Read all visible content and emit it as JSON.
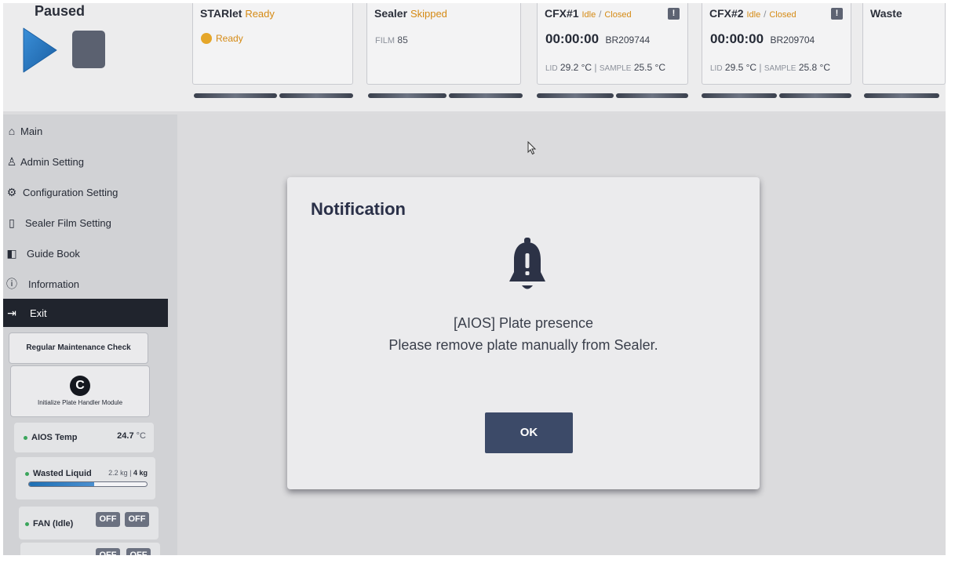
{
  "header": {
    "run_status": "Paused",
    "cards": {
      "starlet": {
        "name": "STARlet",
        "status": "Ready",
        "state_text": "Ready"
      },
      "sealer": {
        "name": "Sealer",
        "status": "Skipped",
        "film_label": "FILM",
        "film_value": "85"
      },
      "cfx1": {
        "name": "CFX#1",
        "status": "Idle",
        "door": "Closed",
        "timer": "00:00:00",
        "barcode": "BR209744",
        "lid_label": "LID",
        "lid_value": "29.2",
        "sample_label": "SAMPLE",
        "sample_value": "25.5",
        "unit": "°C",
        "alert_glyph": "!"
      },
      "cfx2": {
        "name": "CFX#2",
        "status": "Idle",
        "door": "Closed",
        "timer": "00:00:00",
        "barcode": "BR209704",
        "lid_label": "LID",
        "lid_value": "29.5",
        "sample_label": "SAMPLE",
        "sample_value": "25.8",
        "unit": "°C",
        "alert_glyph": "!"
      },
      "waste": {
        "name": "Waste"
      }
    },
    "separator": "/",
    "pipe": "|"
  },
  "sidebar": {
    "menu": [
      {
        "label": "Main",
        "icon": "home-icon",
        "glyph": "⌂"
      },
      {
        "label": "Admin Setting",
        "icon": "admin-icon",
        "glyph": "♙"
      },
      {
        "label": "Configuration Setting",
        "icon": "gear-icon",
        "glyph": "⚙"
      },
      {
        "label": "Sealer Film Setting",
        "icon": "film-icon",
        "glyph": "▯"
      },
      {
        "label": "Guide Book",
        "icon": "book-icon",
        "glyph": "◧"
      },
      {
        "label": "Information",
        "icon": "info-icon",
        "glyph": "ⓘ"
      },
      {
        "label": "Exit",
        "icon": "exit-icon",
        "glyph": "⇥"
      }
    ],
    "maintenance_label": "Regular Maintenance Check",
    "init_label": "Initialize Plate Handler Module",
    "init_glyph": "C",
    "aios_temp": {
      "label": "AIOS Temp",
      "value": "24.7",
      "unit": "°C"
    },
    "wasted_liquid": {
      "label": "Wasted Liquid",
      "value": "2.2 kg",
      "capacity": "4 kg",
      "fill_fraction": 0.55
    },
    "fan": {
      "label": "FAN (Idle)",
      "toggle1": "OFF",
      "toggle2": "OFF"
    },
    "next_toggles": {
      "toggle1": "OFF",
      "toggle2": "OFF"
    }
  },
  "notification": {
    "title": "Notification",
    "icon": "bell-alert-icon",
    "message_line1": "[AIOS] Plate presence",
    "message_line2": "Please remove plate manually from Sealer.",
    "ok_label": "OK"
  },
  "colors": {
    "accent_orange": "#d58a14",
    "ready_dot": "#e5a629",
    "play_blue": "#1f6fb8",
    "modal_button": "#3c4a68",
    "active_menu": "#20242d",
    "status_green": "#3ba55c"
  }
}
